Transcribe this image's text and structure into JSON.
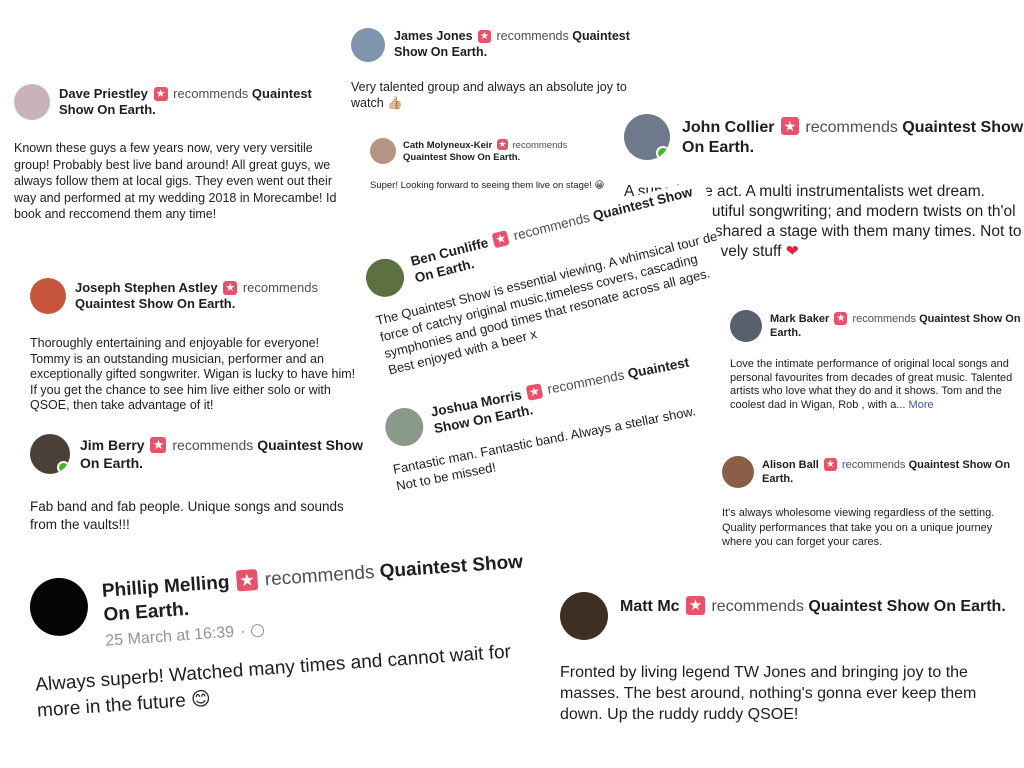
{
  "colors": {
    "recommend_star": "#e9516a",
    "online": "#42b72a",
    "link": "#385898",
    "heart": "#e41e3f"
  },
  "reviews": [
    {
      "name": "Dave Priestley",
      "recommends": "recommends",
      "page": "Quaintest Show On Earth.",
      "text": "Known these guys a few years now, very very versitile group! Probably best live band around! All great guys, we always follow them at local gigs. They even went out their way and performed at my wedding 2018 in Morecambe! Id book and reccomend them any time!"
    },
    {
      "name": "James Jones",
      "recommends": "recommends",
      "page": "Quaintest Show On Earth.",
      "text": "Very talented group and always an absolute joy to watch",
      "emoji": "👍🏼"
    },
    {
      "name": "Cath Molyneux-Keir",
      "recommends": "recommends",
      "page": "Quaintest Show On Earth.",
      "text": "Super! Looking forward to seeing them live on stage!",
      "emoji": "😀"
    },
    {
      "name": "John Collier",
      "recommends": "recommends",
      "page": "Quaintest Show On Earth.",
      "text": "A superb live act. A multi instrumentalists wet dream. Melodic, beautiful songwriting; and modern twists on th'ol classics. I've shared a stage with them many times. Not to be missed. Lovely stuff",
      "emoji": "❤"
    },
    {
      "name": "Joseph Stephen Astley",
      "recommends": "recommends",
      "page": "Quaintest Show On Earth.",
      "text": "Thoroughly entertaining and enjoyable for everyone! Tommy is an outstanding musician, performer and an exceptionally gifted songwriter. Wigan is lucky to have him! If you get the chance to see him live either solo or with QSOE, then take advantage of it!"
    },
    {
      "name": "Ben Cunliffe",
      "recommends": "recommends",
      "page": "Quaintest Show On Earth.",
      "text": "The Quaintest Show is essential viewing. A whimsical tour de force of catchy original music,timeless covers, cascading symphonies and good times that resonate across all ages. Best enjoyed with a beer x"
    },
    {
      "name": "Mark Baker",
      "recommends": "recommends",
      "page": "Quaintest Show On Earth.",
      "text": "Love the intimate performance of original local songs and personal favourites from decades of great music. Talented artists who love what they do and it shows. Tom and the coolest dad in Wigan, Rob , with a...",
      "more": "More"
    },
    {
      "name": "Jim Berry",
      "recommends": "recommends",
      "page": "Quaintest Show On Earth.",
      "text": "Fab band and fab people. Unique songs and sounds from the vaults!!!"
    },
    {
      "name": "Joshua Morris",
      "recommends": "recommends",
      "page": "Quaintest Show On Earth.",
      "text": "Fantastic man. Fantastic band. Always a stellar show. Not to be missed!"
    },
    {
      "name": "Alison Ball",
      "recommends": "recommends",
      "page": "Quaintest Show On Earth.",
      "text": "It's always wholesome viewing regardless of the setting. Quality performances that take you on a unique journey where you can forget your cares."
    },
    {
      "name": "Phillip Melling",
      "recommends": "recommends",
      "page": "Quaintest Show On Earth.",
      "timestamp": "25 March at 16:39",
      "separator": "·",
      "text": "Always superb! Watched many times and cannot wait for more in the future",
      "emoji": "😊"
    },
    {
      "name": "Matt Mc",
      "recommends": "recommends",
      "page": "Quaintest Show On Earth.",
      "text": "Fronted by living legend TW Jones and bringing joy to the masses. The best around, nothing's gonna ever keep them down. Up the ruddy ruddy QSOE!"
    }
  ]
}
